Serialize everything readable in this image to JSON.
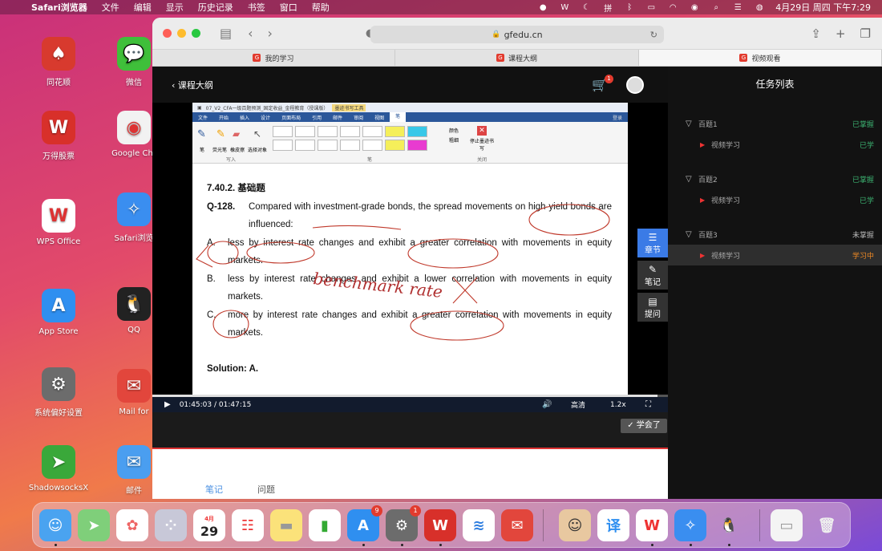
{
  "menubar": {
    "app": "Safari浏览器",
    "items": [
      "文件",
      "编辑",
      "显示",
      "历史记录",
      "书签",
      "窗口",
      "帮助"
    ],
    "datetime": "4月29日 周四 下午7:29"
  },
  "desktop": [
    {
      "label": "同花顺",
      "color": "#d83a2e",
      "glyph": "♠"
    },
    {
      "label": "微信",
      "color": "#3fbf3a",
      "glyph": "💬"
    },
    {
      "label": "万得股票",
      "color": "#d8302a",
      "glyph": "W"
    },
    {
      "label": "Google Chr",
      "color": "#f2f2f2",
      "glyph": "◉"
    },
    {
      "label": "WPS Office",
      "color": "#ffffff",
      "glyph": "W"
    },
    {
      "label": "Safari浏览",
      "color": "#3a8ef0",
      "glyph": "✧"
    },
    {
      "label": "App Store",
      "color": "#2f8ff0",
      "glyph": "A"
    },
    {
      "label": "QQ",
      "color": "#222222",
      "glyph": "🐧"
    },
    {
      "label": "系统偏好设置",
      "color": "#6c6c6c",
      "glyph": "⚙"
    },
    {
      "label": "Mail for",
      "color": "#e2463c",
      "glyph": "✉"
    },
    {
      "label": "ShadowsocksX",
      "color": "#3aa83a",
      "glyph": "➤"
    },
    {
      "label": "邮件",
      "color": "#4a9ef0",
      "glyph": "✉"
    }
  ],
  "browser": {
    "url": "gfedu.cn",
    "tabs": [
      "我的学习",
      "课程大纲",
      "视频观看"
    ]
  },
  "player": {
    "back_label": "课程大纲",
    "cart_badge": "1",
    "time": "01:45:03 / 01:47:15",
    "progress": 0.98,
    "quality": "高清",
    "speed": "1.2x",
    "learned_label": "学会了",
    "side_buttons": [
      "章节",
      "笔记",
      "提问"
    ]
  },
  "document": {
    "window_title": "07_V2_CFA一级百题预测_固定收益_金程教育（授课版）",
    "tool_tab": "墨迹书写工具",
    "ribbon_tabs": [
      "文件",
      "开始",
      "插入",
      "设计",
      "页面布局",
      "引用",
      "邮件",
      "审阅",
      "视图",
      "笔"
    ],
    "ribbon_labels": [
      "笔",
      "荧光笔",
      "橡皮擦",
      "选择对象",
      "写入",
      "笔",
      "颜色",
      "粗细",
      "停止墨迹书写",
      "关闭",
      "登录"
    ],
    "heading": "7.40.2.  基础题",
    "question_label": "Q-128.",
    "question": "Compared with investment-grade bonds, the spread movements on high-yield bonds are influenced:",
    "options": [
      {
        "label": "A.",
        "text": "less by interest rate changes and exhibit a greater correlation with movements in equity markets."
      },
      {
        "label": "B.",
        "text": "less by interest rate changes and exhibit a lower correlation with movements in equity markets."
      },
      {
        "label": "C.",
        "text": "more by interest rate changes and exhibit a greater correlation with movements in equity markets."
      }
    ],
    "solution": "Solution: A.",
    "handwriting": "benchmark rate"
  },
  "tasks": {
    "title": "任务列表",
    "groups": [
      {
        "name": "百题1",
        "status": "已掌握",
        "status_color": "#3cb371",
        "video": "视频学习",
        "video_status": "已学",
        "video_color": "#3cb371"
      },
      {
        "name": "百题2",
        "status": "已掌握",
        "status_color": "#3cb371",
        "video": "视频学习",
        "video_status": "已学",
        "video_color": "#3cb371"
      },
      {
        "name": "百题3",
        "status": "未掌握",
        "status_color": "#bbbbbb",
        "video": "视频学习",
        "video_status": "学习中",
        "video_color": "#f08a24"
      }
    ]
  },
  "subtabs": [
    "笔记",
    "问题"
  ],
  "dock": {
    "calendar_month": "4月",
    "calendar_day": "29",
    "badges": {
      "appstore": "9",
      "settings": "1"
    }
  }
}
